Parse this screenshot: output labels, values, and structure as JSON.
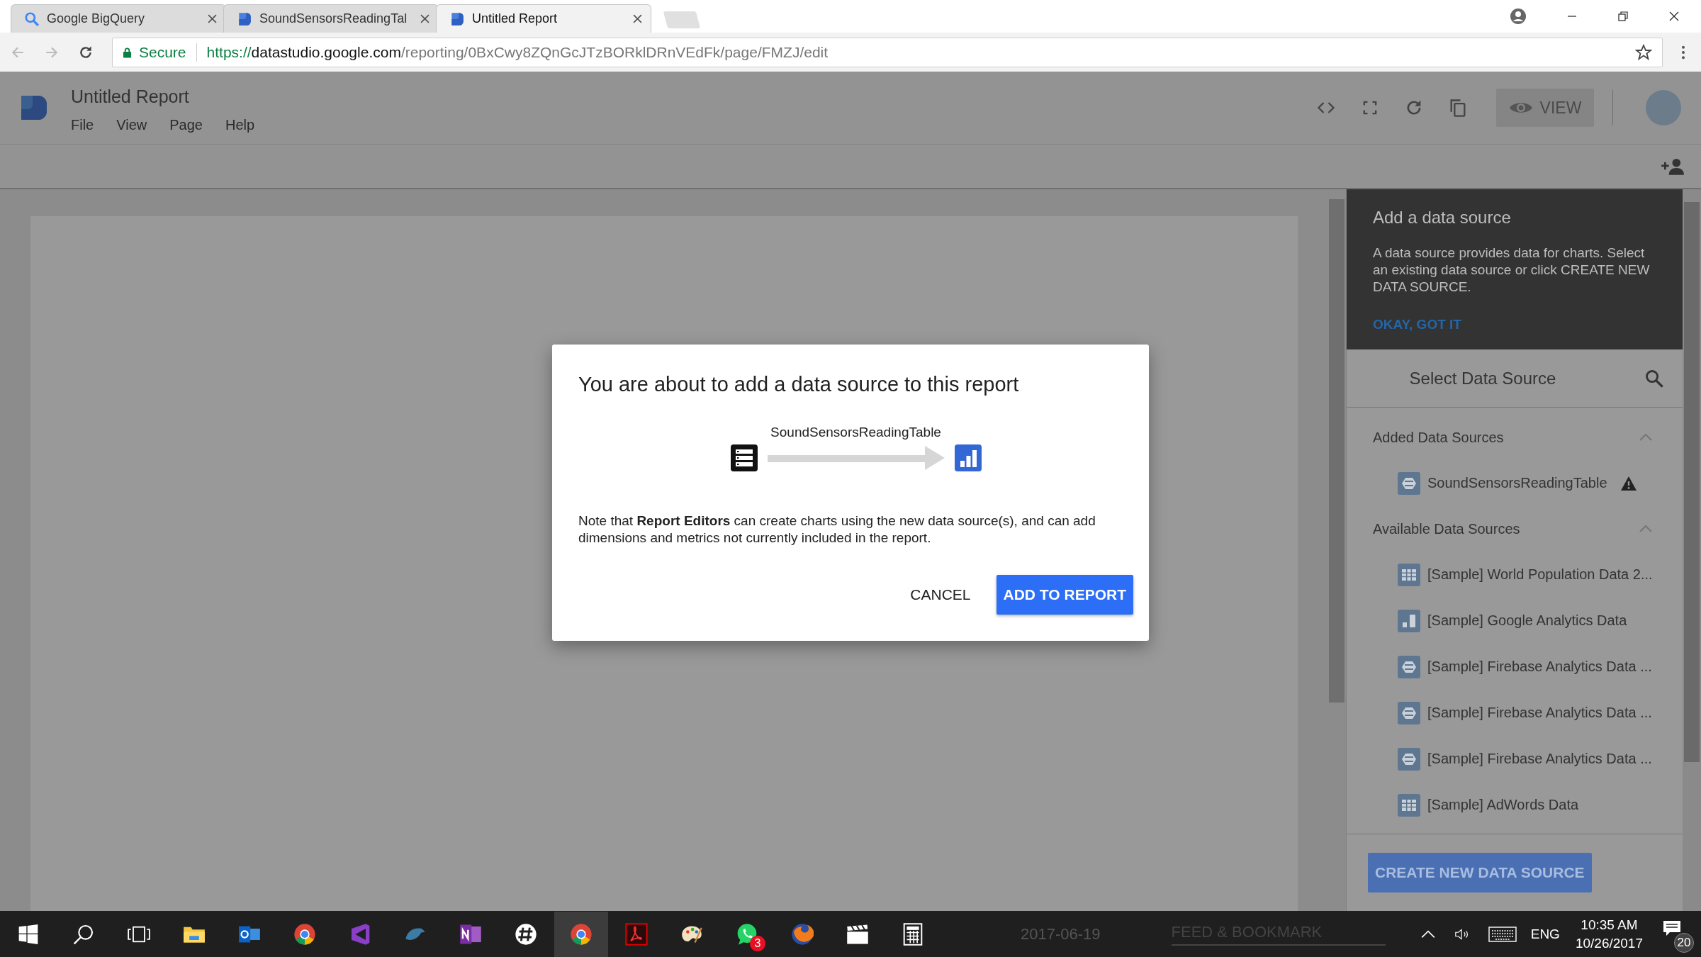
{
  "browser": {
    "tabs": [
      {
        "title": "Google BigQuery",
        "kind": "search",
        "selected": false
      },
      {
        "title": "SoundSensorsReadingTal",
        "kind": "report",
        "selected": false
      },
      {
        "title": "Untitled Report",
        "kind": "report",
        "selected": true
      }
    ],
    "secure_label": "Secure",
    "url_scheme": "https://",
    "url_host": "datastudio.google.com",
    "url_path": "/reporting/0BxCwy8ZQnGcJTzBORklDRnVEdFk/page/FMZJ/edit"
  },
  "report": {
    "title": "Untitled Report",
    "menu": [
      "File",
      "View",
      "Page",
      "Help"
    ],
    "view_button": "VIEW"
  },
  "panel": {
    "tip": {
      "title": "Add a data source",
      "body": "A data source provides data for charts. Select an existing data source or click CREATE NEW DATA SOURCE.",
      "action": "OKAY, GOT IT"
    },
    "title": "Select Data Source",
    "sections": [
      {
        "title": "Added Data Sources",
        "expanded": true,
        "items": [
          {
            "name": "SoundSensorsReadingTable",
            "kind": "database",
            "warning": true
          }
        ]
      },
      {
        "title": "Available Data Sources",
        "expanded": true,
        "items": [
          {
            "name": "[Sample] World Population Data 2...",
            "kind": "table",
            "warning": false
          },
          {
            "name": "[Sample] Google Analytics Data",
            "kind": "analytics",
            "warning": false
          },
          {
            "name": "[Sample] Firebase Analytics Data ...",
            "kind": "database",
            "warning": false
          },
          {
            "name": "[Sample] Firebase Analytics Data ...",
            "kind": "database",
            "warning": false
          },
          {
            "name": "[Sample] Firebase Analytics Data ...",
            "kind": "database",
            "warning": false
          },
          {
            "name": "[Sample] AdWords Data",
            "kind": "table",
            "warning": false
          }
        ]
      }
    ],
    "create_button": "CREATE NEW DATA SOURCE"
  },
  "dialog": {
    "title": "You are about to add a data source to this report",
    "source_name": "SoundSensorsReadingTable",
    "note": "Note that **Report Editors** can create charts using the new data source(s), and can add dimensions and metrics not currently included in the report.",
    "cancel": "CANCEL",
    "confirm": "ADD TO REPORT"
  },
  "taskbar": {
    "background_date": "2017-06-19",
    "background_heading": "FEED & BOOKMARK",
    "chat_badge": "3",
    "language": "ENG",
    "time": "10:35 AM",
    "date": "10/26/2017",
    "notification_count": "20"
  }
}
